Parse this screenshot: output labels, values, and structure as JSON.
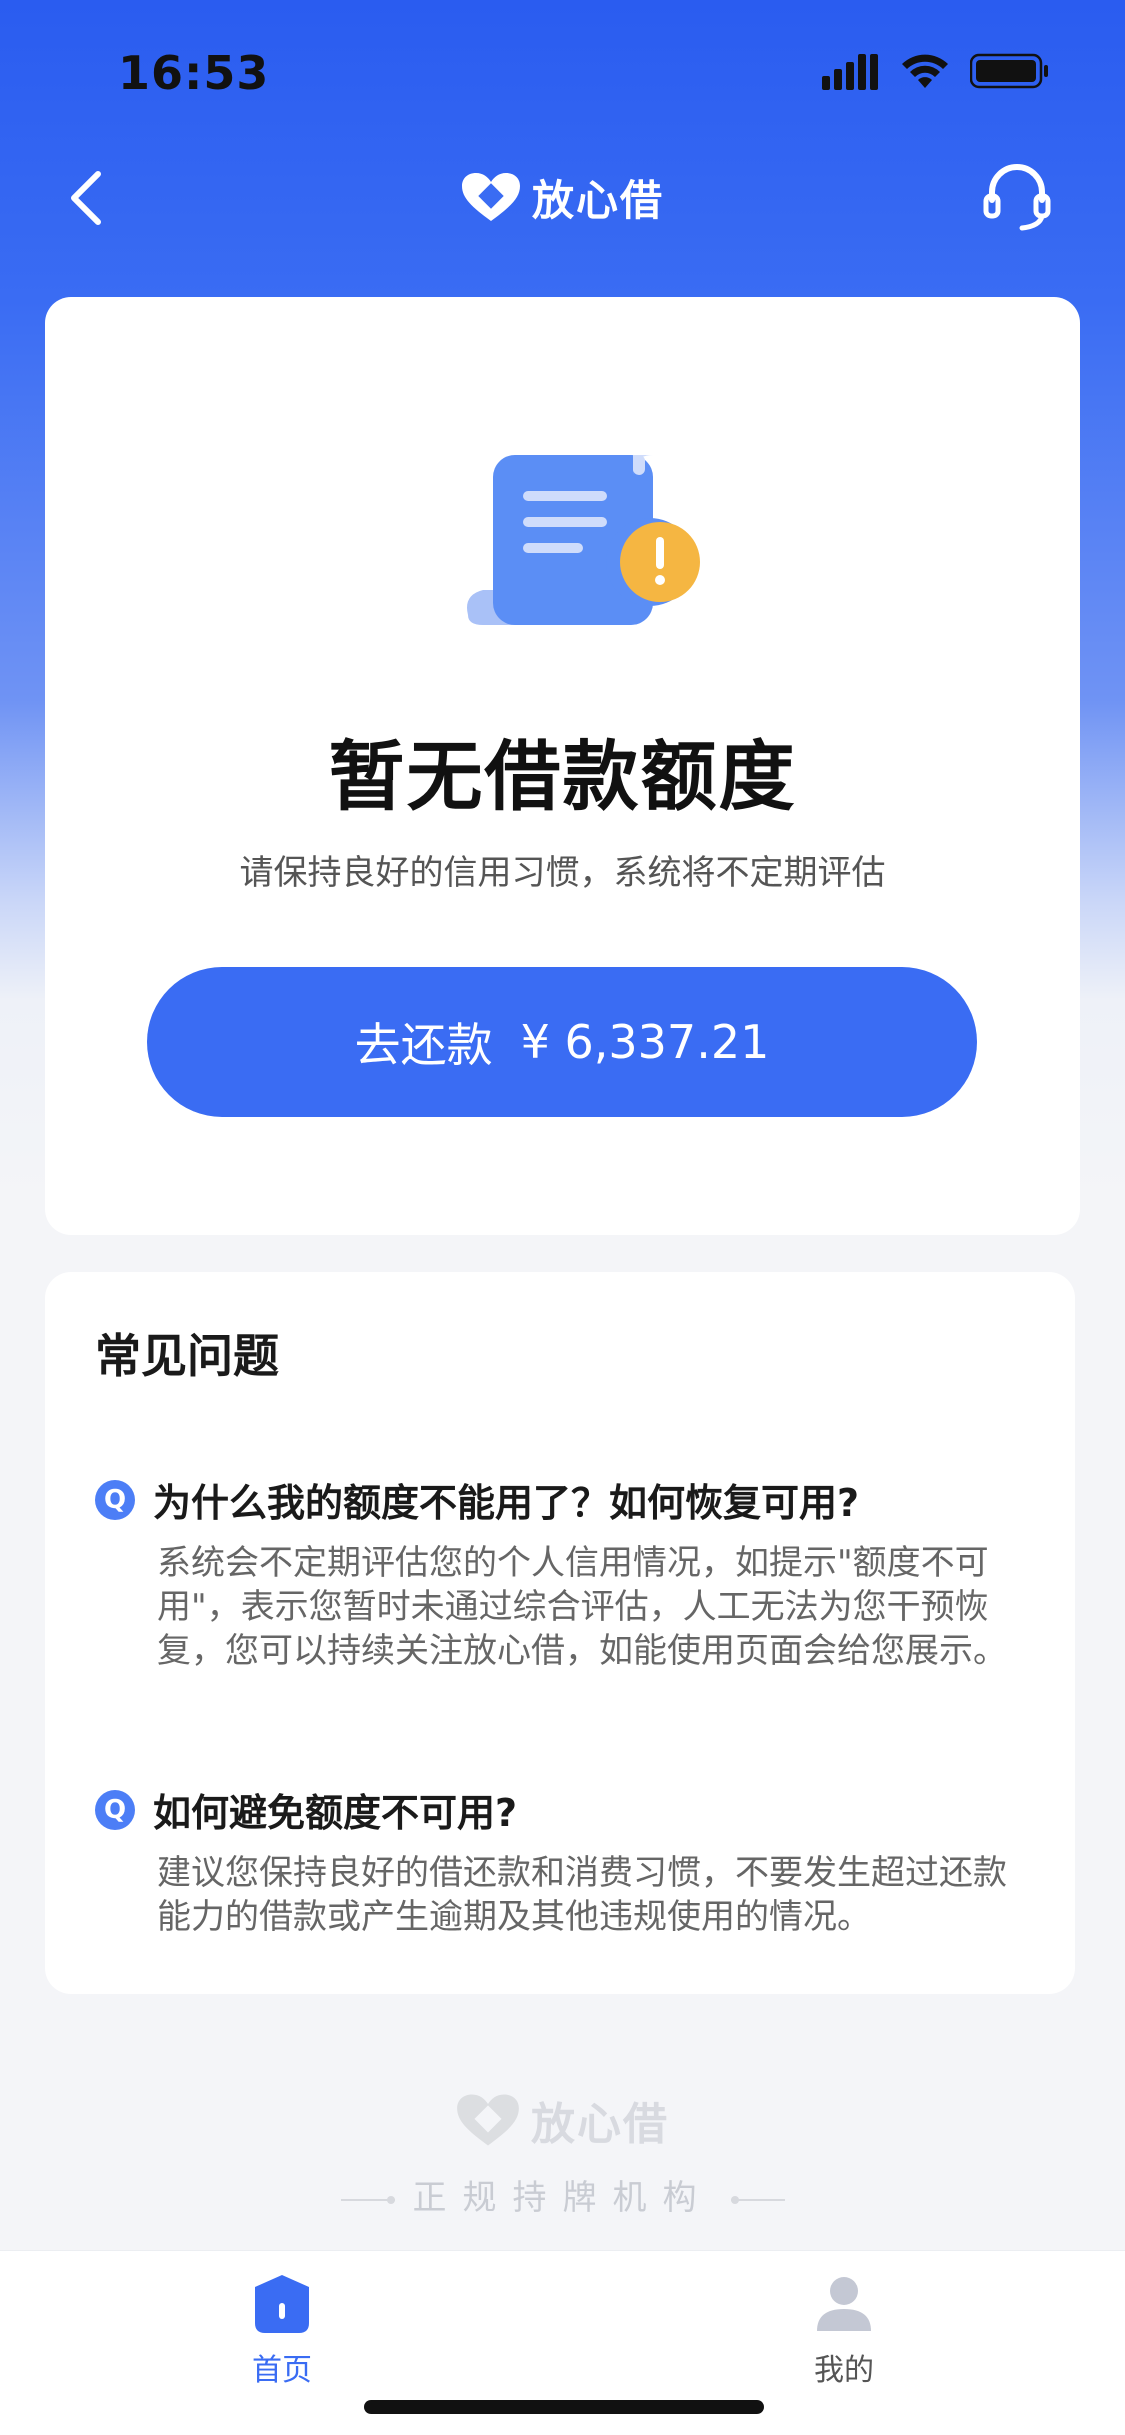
{
  "status_bar": {
    "time": "16:53"
  },
  "nav": {
    "brand": "放心借"
  },
  "main_card": {
    "title": "暂无借款额度",
    "subtitle": "请保持良好的信用习惯，系统将不定期评估",
    "repay_label": "去还款",
    "repay_amount": "¥ 6,337.21"
  },
  "faq": {
    "title": "常见问题",
    "items": [
      {
        "badge": "Q",
        "question": "为什么我的额度不能用了？如何恢复可用?",
        "answer": "系统会不定期评估您的个人信用情况，如提示\"额度不可用\"，表示您暂时未通过综合评估，人工无法为您干预恢复，您可以持续关注放心借，如能使用页面会给您展示。"
      },
      {
        "badge": "Q",
        "question": "如何避免额度不可用?",
        "answer": "建议您保持良好的借还款和消费习惯，不要发生超过还款能力的借款或产生逾期及其他违规使用的情况。"
      }
    ]
  },
  "footer": {
    "brand": "放心借",
    "tagline": "正规持牌机构"
  },
  "tab_bar": {
    "items": [
      {
        "label": "首页",
        "icon": "home-icon",
        "active": true
      },
      {
        "label": "我的",
        "icon": "user-icon",
        "active": false
      }
    ]
  },
  "colors": {
    "primary": "#3a6cf3",
    "badge": "#4c7ef6",
    "warning": "#f5b642"
  }
}
